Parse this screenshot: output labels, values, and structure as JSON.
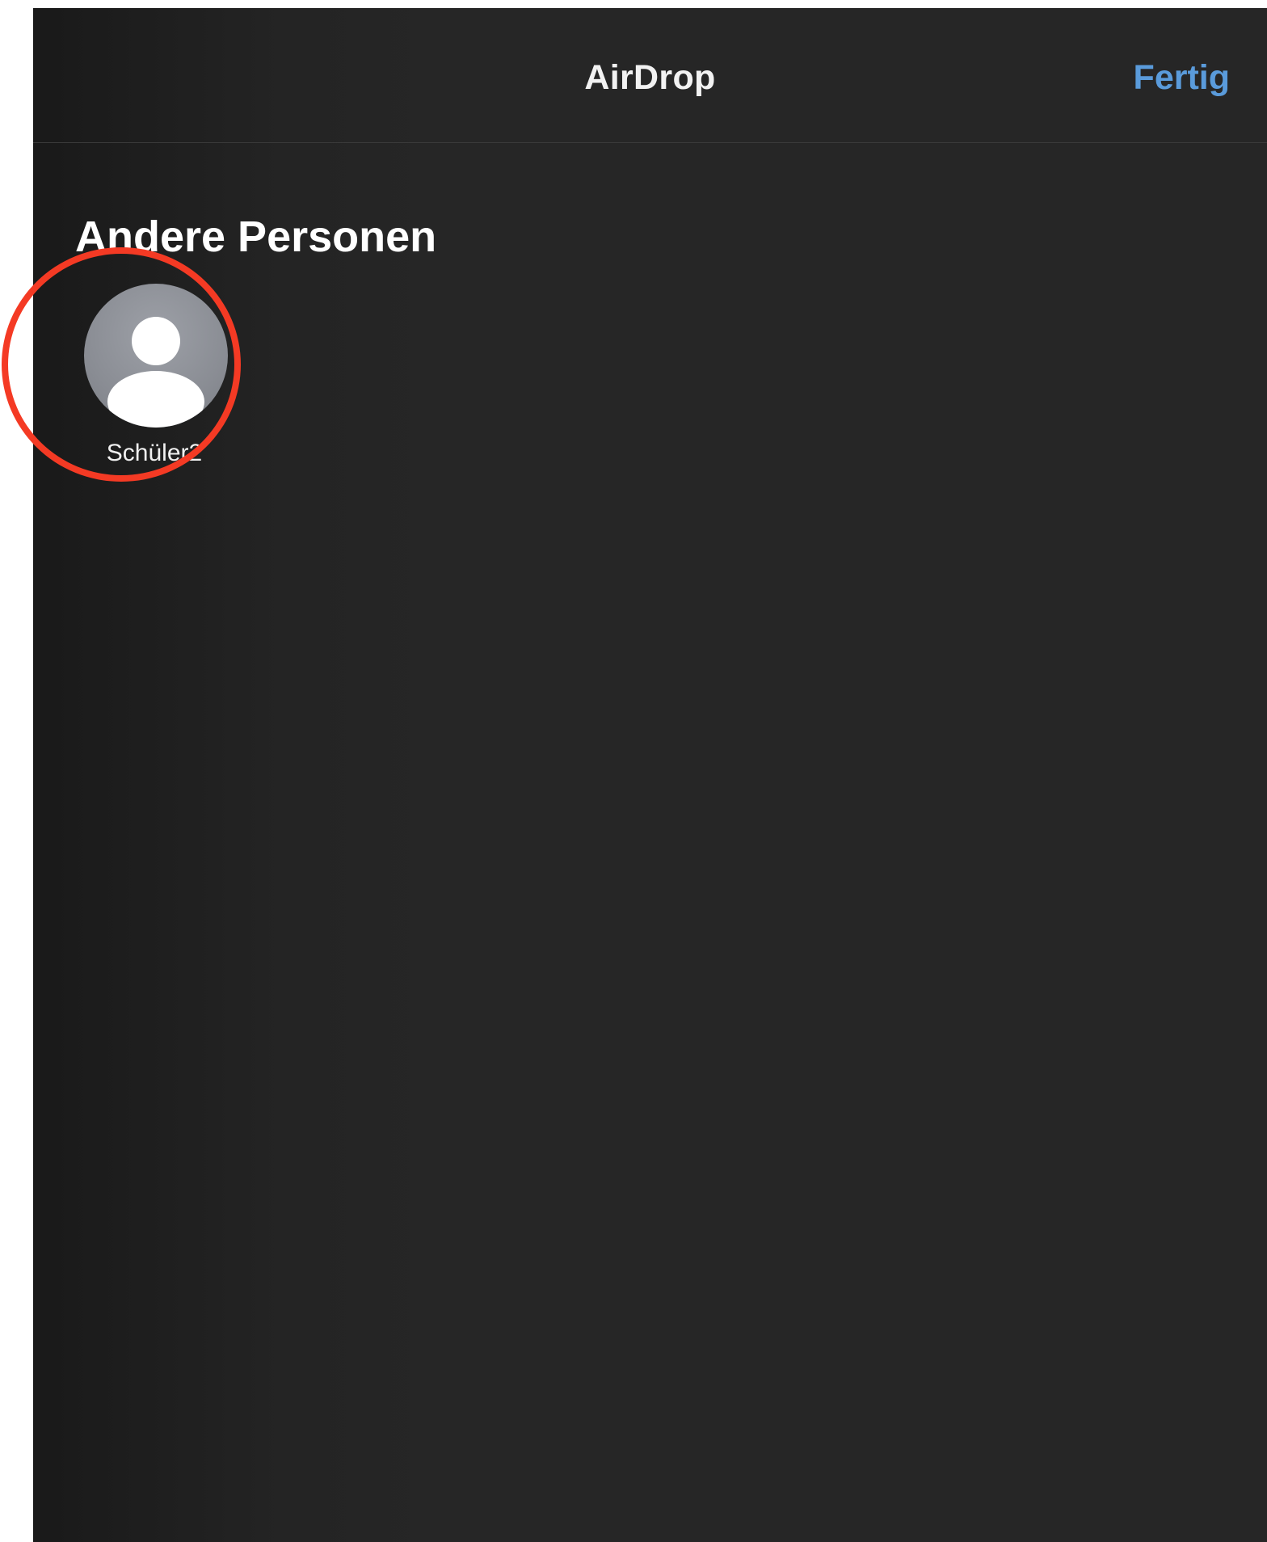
{
  "header": {
    "title": "AirDrop",
    "done_label": "Fertig"
  },
  "section": {
    "title": "Andere Personen"
  },
  "people": [
    {
      "name": "Schüler2",
      "icon": "person-placeholder-icon"
    }
  ],
  "colors": {
    "background": "#262626",
    "accent": "#5a9bdb",
    "highlight": "#f43a24"
  }
}
